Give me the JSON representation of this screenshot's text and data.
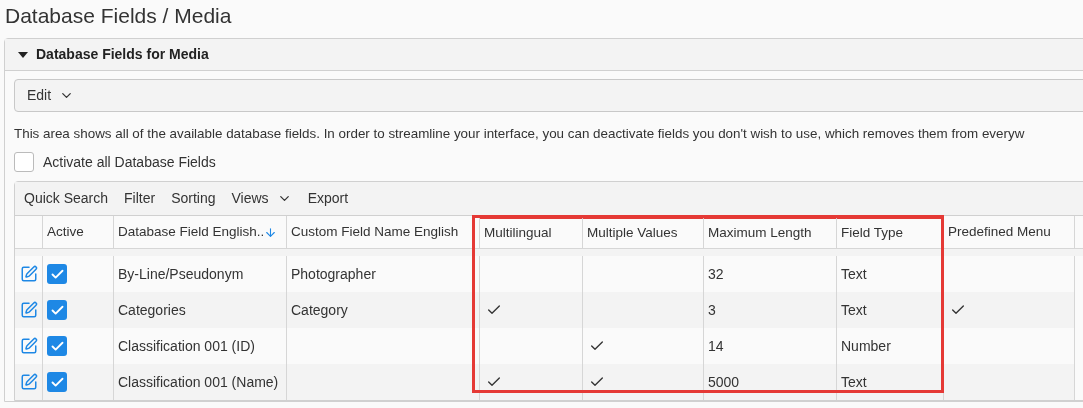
{
  "page_title": "Database Fields / Media",
  "panel": {
    "title": "Database Fields for Media",
    "expanded": true,
    "edit_menu": "Edit",
    "description": "This area shows all of the available database fields. In order to streamline your interface, you can deactivate fields you don't wish to use, which removes them from everyw",
    "activate_all": {
      "label": "Activate all Database Fields",
      "checked": false
    },
    "grid": {
      "toolbar": [
        {
          "label": "Quick Search",
          "has_menu": false
        },
        {
          "label": "Filter",
          "has_menu": false
        },
        {
          "label": "Sorting",
          "has_menu": false
        },
        {
          "label": "Views",
          "has_menu": true
        },
        {
          "label": "Export",
          "has_menu": false
        }
      ],
      "columns": [
        {
          "kind": "edit",
          "highlighted": false,
          "sorted": false
        },
        {
          "kind": "checkbox",
          "label": "Active",
          "highlighted": false,
          "sorted": false
        },
        {
          "kind": "text",
          "label": "Database Field English..",
          "highlighted": false,
          "sorted": true
        },
        {
          "kind": "text",
          "label": "Custom Field Name English",
          "highlighted": false,
          "sorted": false
        },
        {
          "kind": "check",
          "label": "Multilingual",
          "highlighted": true,
          "sorted": false
        },
        {
          "kind": "check",
          "label": "Multiple Values",
          "highlighted": true,
          "sorted": false
        },
        {
          "kind": "text",
          "label": "Maximum Length",
          "highlighted": true,
          "sorted": false
        },
        {
          "kind": "text",
          "label": "Field Type",
          "highlighted": true,
          "sorted": false
        },
        {
          "kind": "check",
          "label": "Predefined Menu",
          "highlighted": false,
          "sorted": false
        }
      ],
      "rows": [
        {
          "cells": [
            {},
            {
              "checked": true
            },
            {
              "text": "By-Line/Pseudonym"
            },
            {
              "text": "Photographer"
            },
            {
              "checked": false
            },
            {
              "checked": false
            },
            {
              "text": "32"
            },
            {
              "text": "Text"
            },
            {
              "checked": false
            }
          ]
        },
        {
          "cells": [
            {},
            {
              "checked": true
            },
            {
              "text": "Categories"
            },
            {
              "text": "Category"
            },
            {
              "checked": true
            },
            {
              "checked": false
            },
            {
              "text": "3"
            },
            {
              "text": "Text"
            },
            {
              "checked": true
            }
          ]
        },
        {
          "cells": [
            {},
            {
              "checked": true
            },
            {
              "text": "Classification 001 (ID)"
            },
            {},
            {
              "checked": false
            },
            {
              "checked": true
            },
            {
              "text": "14"
            },
            {
              "text": "Number"
            },
            {
              "checked": false
            }
          ]
        },
        {
          "cells": [
            {},
            {
              "checked": true
            },
            {
              "text": "Classification 001 (Name)"
            },
            {},
            {
              "checked": true
            },
            {
              "checked": true
            },
            {
              "text": "5000"
            },
            {
              "text": "Text"
            },
            {
              "checked": false
            }
          ]
        }
      ]
    }
  }
}
